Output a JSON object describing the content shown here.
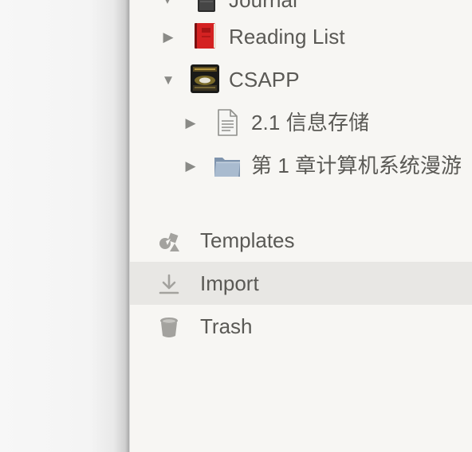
{
  "tree": {
    "journal": {
      "label": "Journal",
      "icon": "black-book-icon",
      "arrow": "chevron-down-icon"
    },
    "reading_list": {
      "label": "Reading List",
      "icon": "red-book-icon",
      "arrow": "triangle-right-icon"
    },
    "csapp": {
      "label": "CSAPP",
      "icon": "book-cover-icon",
      "arrow": "triangle-down-icon",
      "children": [
        {
          "label": "2.1 信息存储",
          "icon": "document-icon",
          "arrow": "triangle-right-icon"
        },
        {
          "label": "第 1 章计算机系统漫游",
          "icon": "folder-icon",
          "arrow": "triangle-right-icon"
        }
      ]
    }
  },
  "sections": {
    "templates": {
      "label": "Templates",
      "icon": "templates-shapes-icon"
    },
    "import": {
      "label": "Import",
      "icon": "download-icon"
    },
    "trash": {
      "label": "Trash",
      "icon": "trash-icon"
    }
  },
  "colors": {
    "sidebar_bg": "#f7f6f3",
    "active_row_bg": "#e8e7e4",
    "text": "#5a5955",
    "icon_gray": "#8a8a86"
  }
}
